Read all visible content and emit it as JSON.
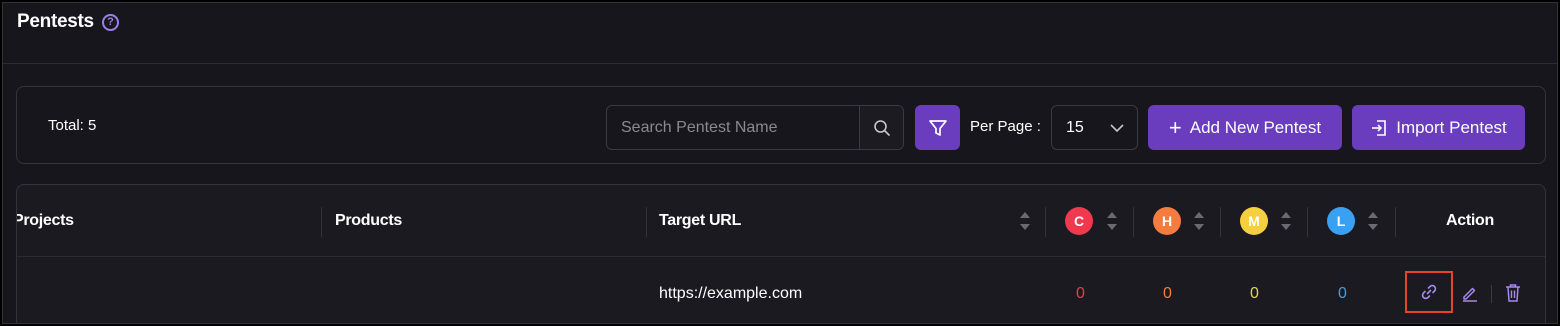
{
  "page": {
    "title": "Pentests",
    "help_icon": "?"
  },
  "toolbar": {
    "total": "Total: 5",
    "search": {
      "placeholder": "Search Pentest Name",
      "value": ""
    },
    "per_page_label": "Per Page :",
    "per_page_value": "15",
    "add_label": "Add New Pentest",
    "add_icon": "+",
    "import_label": "Import Pentest"
  },
  "table": {
    "headers": {
      "projects": "Projects",
      "products": "Products",
      "target_url": "Target URL",
      "critical": "C",
      "high": "H",
      "medium": "M",
      "low": "L",
      "action": "Action"
    },
    "rows": [
      {
        "projects": "",
        "products": "",
        "target_url": "https://example.com",
        "critical": "0",
        "high": "0",
        "medium": "0",
        "low": "0"
      }
    ]
  },
  "colors": {
    "accent": "#6a3cbe",
    "critical": "#f0384f",
    "high": "#f57c3f",
    "medium": "#f4d03f",
    "low": "#3aa0f2",
    "highlight": "#e8442a"
  }
}
